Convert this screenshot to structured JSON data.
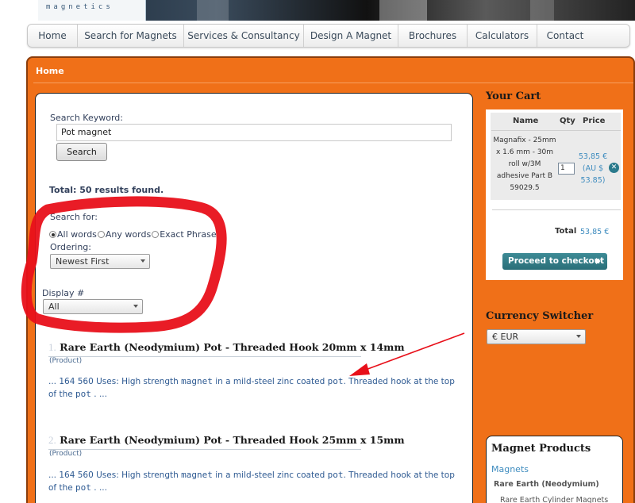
{
  "logo": {
    "text": "magnetics"
  },
  "nav": {
    "items": [
      "Home",
      "Search for Magnets",
      "Services & Consultancy",
      "Design A Magnet",
      "Brochures",
      "Calculators",
      "Contact"
    ]
  },
  "breadcrumb": "Home",
  "search": {
    "keyword_label": "Search Keyword:",
    "keyword_value": "Pot magnet",
    "button_label": "Search",
    "total": "Total: 50 results found.",
    "search_for_label": "Search for:",
    "options": [
      "All words",
      "Any words",
      "Exact Phrase"
    ],
    "selected_option": "All words",
    "ordering_label": "Ordering:",
    "ordering_value": "Newest First",
    "display_label": "Display #",
    "display_value": "All"
  },
  "results": [
    {
      "num": "1.",
      "title": "Rare Earth (Neodymium) Pot - Threaded Hook 20mm x 14mm",
      "type": "(Product)",
      "snippet_a": "... 164 560 Uses: High strength",
      "hl1": "magnet",
      "snippet_b": "in a mild-steel zinc coated",
      "hl2": "pot",
      "snippet_c": ". Threaded hook at the top",
      "snippet_d": "of the",
      "hl3": "pot",
      "snippet_e": ". ..."
    },
    {
      "num": "2.",
      "title": "Rare Earth (Neodymium) Pot - Threaded Hook 25mm x 15mm",
      "type": "(Product)",
      "snippet_a": "... 164 560 Uses: High strength",
      "hl1": "magnet",
      "snippet_b": "in a mild-steel zinc coated",
      "hl2": "pot",
      "snippet_c": ". Threaded hook at the top",
      "snippet_d": "of the",
      "hl3": "pot",
      "snippet_e": ". ..."
    }
  ],
  "cart": {
    "title": "Your Cart",
    "col_name": "Name",
    "col_qty": "Qty",
    "col_price": "Price",
    "item_name_lines": [
      "Magnafix - 25mm",
      "x 1.6 mm - 30m",
      "roll w/3M",
      "adhesive Part B",
      "59029.5"
    ],
    "item_qty": "1",
    "item_price_lines": [
      "53,85 €",
      "(AU $",
      "53.85)"
    ],
    "total_label": "Total",
    "total_value": "53,85 €",
    "checkout_label": "Proceed to checkout"
  },
  "currency": {
    "title": "Currency Switcher",
    "value": "€ EUR"
  },
  "products": {
    "title": "Magnet Products",
    "link": "Magnets",
    "sub": "Rare Earth (Neodymium)",
    "subsub": "Rare Earth Cylinder Magnets"
  },
  "colors": {
    "frame_orange": "#f07018",
    "annotation_red": "#e8101a",
    "checkout_teal": "#2a7a8c",
    "link_blue": "#3e8cbf"
  }
}
